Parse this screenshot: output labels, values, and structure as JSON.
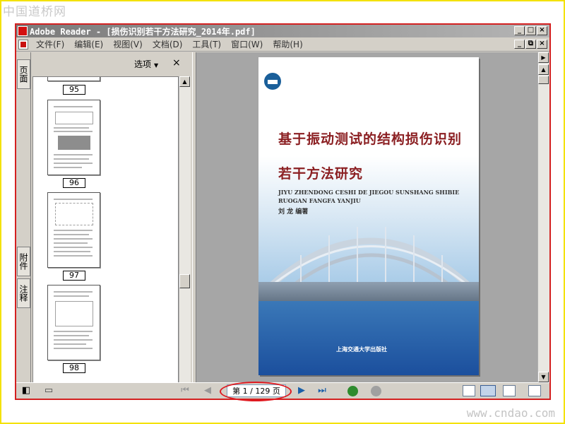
{
  "site": {
    "logo_text": "中国道桥网",
    "url": "www.cndao.com"
  },
  "window": {
    "title": "Adobe Reader - [损伤识别若干方法研究_2014年.pdf]",
    "controls": [
      "_",
      "□",
      "×"
    ],
    "doc_controls": [
      "_",
      "⧉",
      "×"
    ]
  },
  "menu": {
    "items": [
      "文件(F)",
      "编辑(E)",
      "视图(V)",
      "文档(D)",
      "工具(T)",
      "窗口(W)",
      "帮助(H)"
    ]
  },
  "side_tabs": {
    "pages": "页面",
    "attachments": "附件",
    "comments": "注释"
  },
  "thumb_panel": {
    "options_label": "选项",
    "close_glyph": "×",
    "page_labels": [
      "95",
      "96",
      "97",
      "98"
    ]
  },
  "cover": {
    "title_line1": "基于振动测试的结构损伤识别",
    "title_line2": "若干方法研究",
    "pinyin_line1": "JIYU ZHENDONG CESHI DE JIEGOU SUNSHANG SHIBIE",
    "pinyin_line2": "RUOGAN FANGFA YANJIU",
    "author": "刘 龙 编著",
    "publisher": "上海交通大学出版社"
  },
  "navigation": {
    "page_indicator": "第 1 / 129 页",
    "current_page": 1,
    "total_pages": 129
  },
  "colors": {
    "accent_red": "#d32020",
    "frame_yellow": "#f4e200",
    "cover_title": "#8b1f22",
    "nav_blue": "#1a5fa8",
    "go_green": "#2e8b2e"
  }
}
